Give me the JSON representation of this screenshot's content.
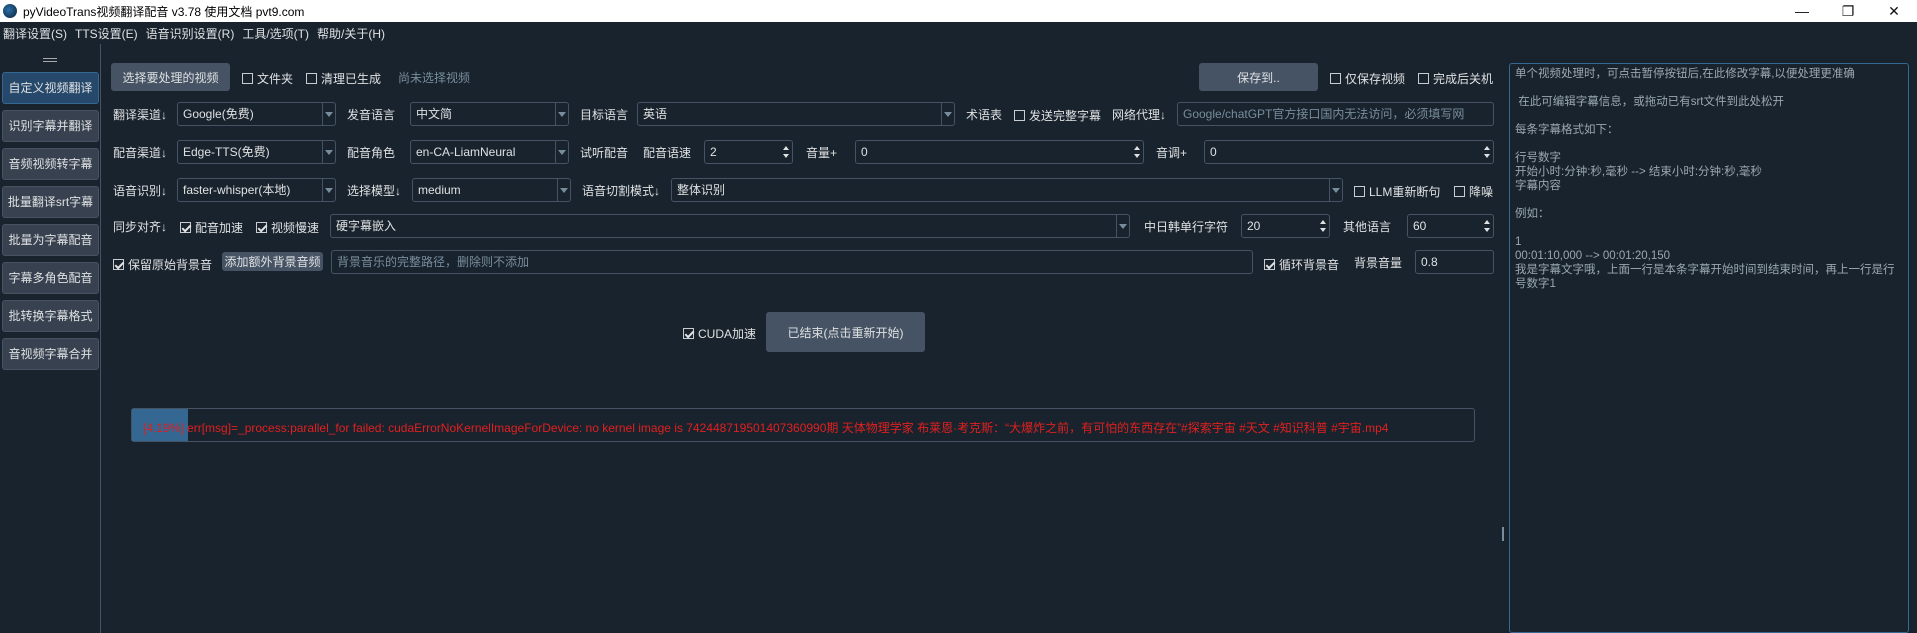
{
  "window": {
    "title": "pyVideoTrans视频翻译配音 v3.78  使用文档  pvt9.com"
  },
  "menu": [
    "翻译设置(S)",
    "TTS设置(E)",
    "语音识别设置(R)",
    "工具/选项(T)",
    "帮助/关于(H)"
  ],
  "sidebar": [
    "自定义视频翻译",
    "识别字幕并翻译",
    "音频视频转字幕",
    "批量翻译srt字幕",
    "批量为字幕配音",
    "字幕多角色配音",
    "批转换字幕格式",
    "音视频字幕合并"
  ],
  "row1": {
    "select_video": "选择要处理的视频",
    "folder": "文件夹",
    "clear": "清理已生成",
    "status": "尚未选择视频",
    "save_to": "保存到..",
    "only_video": "仅保存视频",
    "shutdown": "完成后关机"
  },
  "row2": {
    "translate_label": "翻译渠道↓",
    "translate_value": "Google(免费)",
    "source_label": "发音语言",
    "source_value": "中文简",
    "target_label": "目标语言",
    "target_value": "英语",
    "glossary": "术语表",
    "send_full": "发送完整字幕",
    "proxy_label": "网络代理↓",
    "proxy_placeholder": "Google/chatGPT官方接口国内无法访问，必须填写网"
  },
  "row3": {
    "dub_label": "配音渠道↓",
    "dub_value": "Edge-TTS(免费)",
    "role_label": "配音角色",
    "role_value": "en-CA-LiamNeural",
    "listen": "试听配音",
    "rate_label": "配音语速",
    "rate_value": "2",
    "volume_label": "音量+",
    "volume_value": "0",
    "pitch_label": "音调+",
    "pitch_value": "0"
  },
  "row4": {
    "asr_label": "语音识别↓",
    "asr_value": "faster-whisper(本地)",
    "model_label": "选择模型↓",
    "model_value": "medium",
    "split_label": "语音切割模式↓",
    "split_value": "整体识别",
    "llm": "LLM重新断句",
    "denoise": "降噪"
  },
  "row5": {
    "sync_label": "同步对齐↓",
    "dub_accel": "配音加速",
    "video_slow": "视频慢速",
    "subtitle_value": "硬字幕嵌入",
    "cjk_label": "中日韩单行字符",
    "cjk_value": "20",
    "other_label": "其他语言",
    "other_value": "60"
  },
  "row6": {
    "keep_bg": "保留原始背景音",
    "add_bg": "添加额外背景音频",
    "bg_placeholder": "背景音乐的完整路径，删除则不添加",
    "loop_bg": "循环背景音",
    "bg_vol_label": "背景音量",
    "bg_vol_value": "0.8"
  },
  "actions": {
    "cuda": "CUDA加速",
    "start": "已结束(点击重新开始)"
  },
  "progress": {
    "percent": 4.19,
    "text": "[4.19%]   err[msg]=_process:parallel_for failed: cudaErrorNoKernelImageForDevice: no kernel image is   7424487195014073609​90期  天体物理学家 布莱恩·考克斯：“大爆炸之前，有可怕的东西存在”#探索宇宙 #天文 #知识科普 #宇宙.mp4"
  },
  "subtitle_panel": {
    "lines": [
      "单个视频处理时，可点击暂停按钮后,在此修改字幕,以便处理更准确",
      "",
      " 在此可编辑字幕信息，或拖动已有srt文件到此处松开",
      "",
      "每条字幕格式如下：",
      "",
      "行号数字",
      "开始小时:分钟:秒,毫秒 --> 结束小时:分钟:秒,毫秒",
      "字幕内容",
      "",
      "例如：",
      "",
      "1",
      "00:01:10,000 --> 00:01:20,150",
      "我是字幕文字哦，上面一行是本条字幕开始时间到结束时间，再上一行是行号数字1"
    ]
  }
}
